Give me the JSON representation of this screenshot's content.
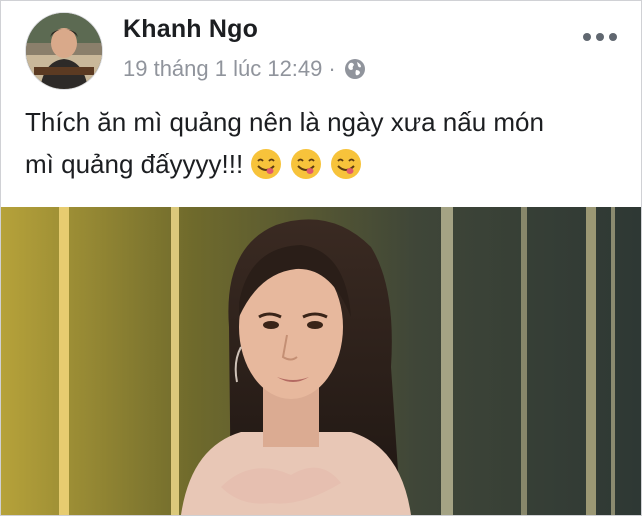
{
  "post": {
    "author": {
      "name": "Khanh Ngo",
      "avatar_icon": "profile-photo"
    },
    "meta": {
      "timestamp": "19 tháng 1 lúc 12:49",
      "separator": "·",
      "privacy_icon": "globe-icon"
    },
    "menu_icon": "more-options-icon",
    "text_lines": [
      "Thích ăn mì quảng nên là ngày xưa nấu món",
      "mì quảng đấyyyy!!!"
    ],
    "emoji": [
      "yum-face-emoji",
      "yum-face-emoji",
      "yum-face-emoji"
    ],
    "image_icon": "post-photo"
  },
  "colors": {
    "name": "#1c1e21",
    "meta": "#90949c",
    "border": "#d0d1d5",
    "emoji_face": "#f7c33b"
  }
}
